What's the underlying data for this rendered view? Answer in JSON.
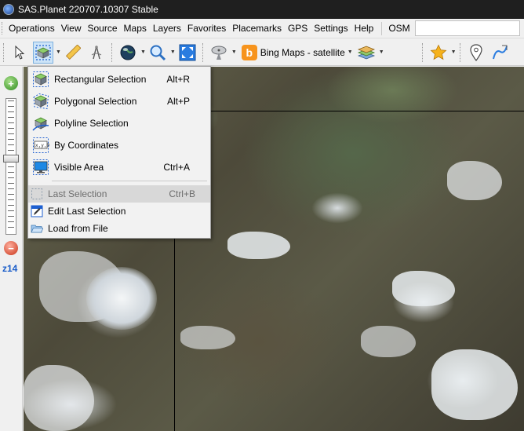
{
  "window": {
    "title": "SAS.Planet 220707.10307 Stable"
  },
  "menubar": {
    "items": [
      "Operations",
      "View",
      "Source",
      "Maps",
      "Layers",
      "Favorites",
      "Placemarks",
      "GPS",
      "Settings",
      "Help"
    ],
    "osm_label": "OSM",
    "osm_value": ""
  },
  "toolbar": {
    "map_source": "Bing Maps - satellite"
  },
  "zoom": {
    "level": "z14"
  },
  "selection_menu": {
    "items": [
      {
        "label": "Rectangular Selection",
        "shortcut": "Alt+R"
      },
      {
        "label": "Polygonal Selection",
        "shortcut": "Alt+P"
      },
      {
        "label": "Polyline Selection",
        "shortcut": ""
      },
      {
        "label": "By Coordinates",
        "shortcut": ""
      },
      {
        "label": "Visible Area",
        "shortcut": "Ctrl+A"
      }
    ],
    "secondary": [
      {
        "label": "Last Selection",
        "shortcut": "Ctrl+B"
      },
      {
        "label": "Edit Last Selection",
        "shortcut": ""
      },
      {
        "label": "Load from File",
        "shortcut": ""
      }
    ]
  },
  "colors": {
    "titlebar_bg": "#1f1f1f",
    "highlight": "#d8d8d8",
    "zoom_level_text": "#1a5dc9",
    "bing_orange": "#f7941d"
  }
}
